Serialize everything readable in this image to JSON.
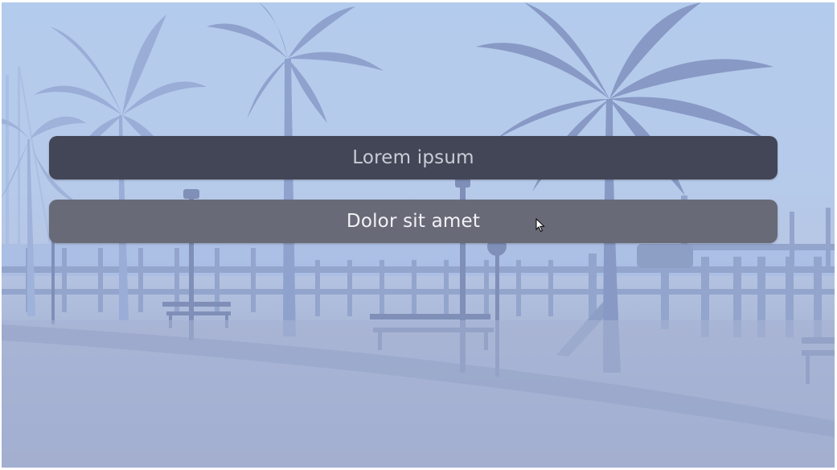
{
  "menu": {
    "buttons": [
      {
        "label": "Lorem ipsum"
      },
      {
        "label": "Dolor sit amet"
      }
    ]
  },
  "colors": {
    "sky": "#b3cbed",
    "ground": "#9eabcc",
    "silhouette": "#8e9fc6",
    "button_primary": "#434656",
    "button_secondary": "#686a78"
  },
  "background": {
    "icon": "seaside-promenade-background"
  },
  "cursor": {
    "icon": "mouse-pointer-icon"
  }
}
